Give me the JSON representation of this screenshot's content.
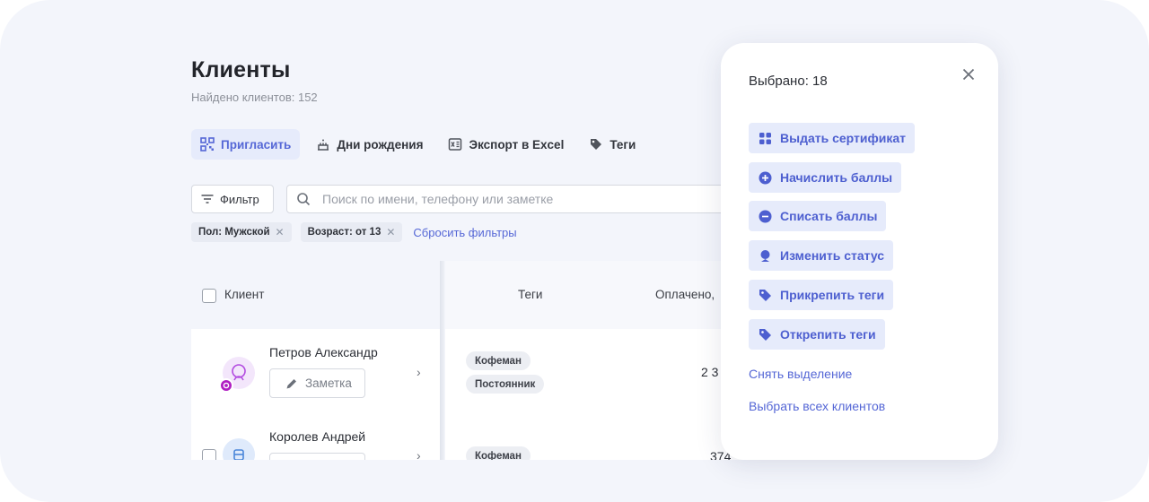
{
  "page": {
    "title": "Клиенты",
    "subtitle": "Найдено клиентов: 152"
  },
  "toolbar": {
    "invite": "Пригласить",
    "birthdays": "Дни рождения",
    "export": "Экспорт в Excel",
    "tags": "Теги"
  },
  "filters": {
    "filter_label": "Фильтр",
    "search_placeholder": "Поиск по имени, телефону или заметке",
    "chips": [
      "Пол: Мужской",
      "Возраст: от 13"
    ],
    "reset": "Сбросить фильтры"
  },
  "table": {
    "columns": {
      "client": "Клиент",
      "tags": "Теги",
      "paid": "Оплачено,"
    },
    "rows": [
      {
        "name": "Петров Александр",
        "note_label": "Заметка",
        "tags": [
          "Кофеман",
          "Постоянник"
        ],
        "paid": "2 3"
      },
      {
        "name": "Королев Андрей",
        "note_label": "",
        "tags": [
          "Кофеман"
        ],
        "paid": "374"
      }
    ]
  },
  "popup": {
    "title": "Выбрано: 18",
    "actions": [
      {
        "label": "Выдать сертификат",
        "icon": "certificate-icon"
      },
      {
        "label": "Начислить баллы",
        "icon": "plus-circle-icon"
      },
      {
        "label": "Списать баллы",
        "icon": "minus-circle-icon"
      },
      {
        "label": "Изменить статус",
        "icon": "status-icon"
      },
      {
        "label": "Прикрепить теги",
        "icon": "tag-icon"
      },
      {
        "label": "Открепить теги",
        "icon": "tag-icon"
      }
    ],
    "deselect": "Снять выделение",
    "select_all": "Выбрать всех клиентов"
  },
  "colors": {
    "accent": "#5567d6",
    "accent_bg": "#e6ebfb",
    "canvas_bg": "#f3f5fb",
    "avatar_purple": "#b24be0"
  }
}
